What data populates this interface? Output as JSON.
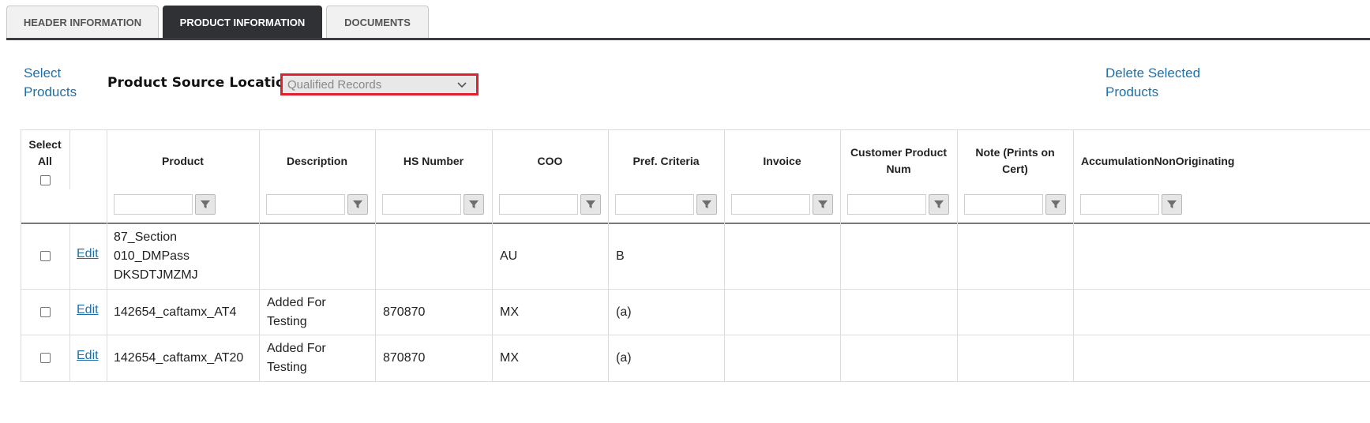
{
  "tabs": [
    {
      "label": "HEADER INFORMATION"
    },
    {
      "label": "PRODUCT INFORMATION"
    },
    {
      "label": "DOCUMENTS"
    }
  ],
  "toolbar": {
    "select_products": "Select Products",
    "product_source_label": "Product Source Location",
    "product_source_value": "Qualified Records",
    "delete_selected": "Delete Selected Products"
  },
  "table": {
    "select_all_label": "Select All",
    "columns": [
      "Product",
      "Description",
      "HS Number",
      "COO",
      "Pref. Criteria",
      "Invoice",
      "Customer Product Num",
      "Note (Prints on Cert)",
      "AccumulationNonOriginating"
    ],
    "edit_label": "Edit",
    "rows": [
      {
        "product": "87_Section 010_DMPass DKSDTJMZMJ",
        "description": "",
        "hs": "",
        "coo": "AU",
        "pref": "B"
      },
      {
        "product": "142654_caftamx_AT4",
        "description": "Added For Testing",
        "hs": "870870",
        "coo": "MX",
        "pref": "(a)"
      },
      {
        "product": "142654_caftamx_AT20",
        "description": "Added For Testing",
        "hs": "870870",
        "coo": "MX",
        "pref": "(a)"
      }
    ]
  },
  "colors": {
    "accent_link": "#1f6fa8",
    "active_tab": "#2f3135",
    "highlight_border": "#e0202e"
  }
}
